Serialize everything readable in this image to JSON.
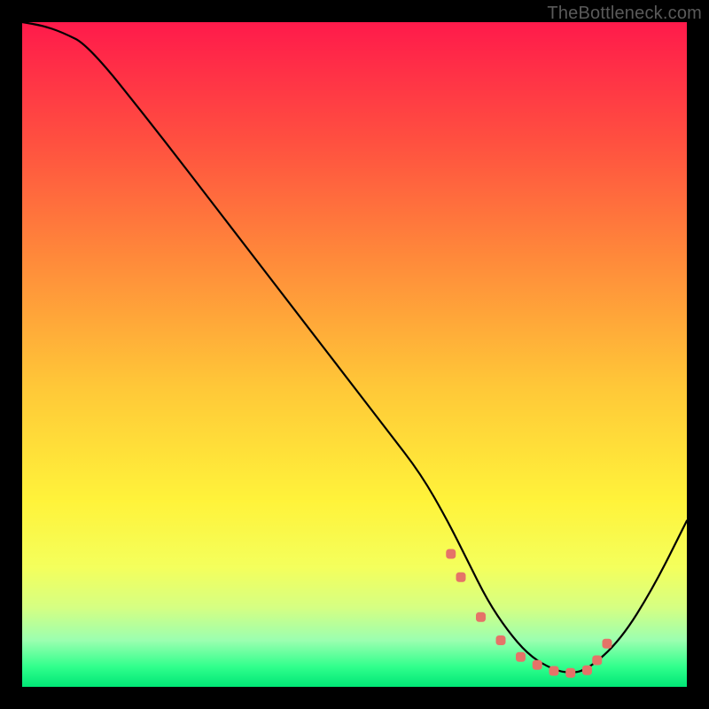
{
  "watermark": "TheBottleneck.com",
  "colors": {
    "black_frame": "#000000",
    "curve_stroke": "#000000",
    "marker_fill": "#e57368",
    "gradient_top": "#ff1a4b",
    "gradient_bottom": "#00e676"
  },
  "chart_data": {
    "type": "line",
    "title": "",
    "xlabel": "",
    "ylabel": "",
    "xlim": [
      0,
      100
    ],
    "ylim": [
      0,
      100
    ],
    "x": [
      0,
      3,
      6,
      10,
      20,
      30,
      40,
      50,
      55,
      60,
      64,
      67,
      70,
      73,
      76,
      79,
      82,
      85,
      90,
      95,
      100
    ],
    "values": [
      100,
      99.5,
      98.5,
      96.5,
      84,
      71,
      58,
      45,
      38.5,
      32,
      25,
      19,
      13,
      8.5,
      5,
      3,
      2,
      2.5,
      7,
      15,
      25
    ],
    "markers": {
      "x": [
        64.5,
        66,
        69,
        72,
        75,
        77.5,
        80,
        82.5,
        85,
        86.5,
        88
      ],
      "y": [
        20,
        16.5,
        10.5,
        7,
        4.5,
        3.3,
        2.4,
        2.1,
        2.5,
        4,
        6.5
      ]
    }
  }
}
